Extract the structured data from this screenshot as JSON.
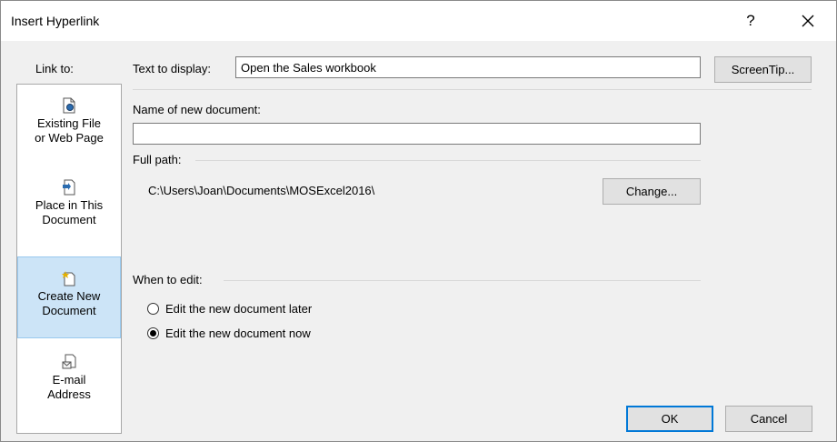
{
  "dialog": {
    "title": "Insert Hyperlink",
    "help_label": "?",
    "close_label": "✕"
  },
  "link_to": {
    "label": "Link to:",
    "items": [
      {
        "line1": "Existing File",
        "line2": "or Web Page",
        "icon": "file-globe-icon"
      },
      {
        "line1": "Place in This",
        "line2": "Document",
        "icon": "document-place-icon"
      },
      {
        "line1": "Create New",
        "line2": "Document",
        "icon": "new-document-icon",
        "selected": true
      },
      {
        "line1": "E-mail",
        "line2": "Address",
        "icon": "email-icon"
      }
    ]
  },
  "text_to_display": {
    "label": "Text to display:",
    "value": "Open the Sales workbook"
  },
  "screentip_label": "ScreenTip...",
  "new_document": {
    "label": "Name of new document:",
    "value": ""
  },
  "full_path": {
    "label": "Full path:",
    "value": "C:\\Users\\Joan\\Documents\\MOSExcel2016\\"
  },
  "change_label": "Change...",
  "when_to_edit": {
    "label": "When to edit:",
    "options": [
      {
        "label": "Edit the new document later",
        "checked": false
      },
      {
        "label": "Edit the new document now",
        "checked": true
      }
    ]
  },
  "ok_label": "OK",
  "cancel_label": "Cancel",
  "colors": {
    "selected_bg": "#cce4f7",
    "accent": "#0078d7"
  }
}
